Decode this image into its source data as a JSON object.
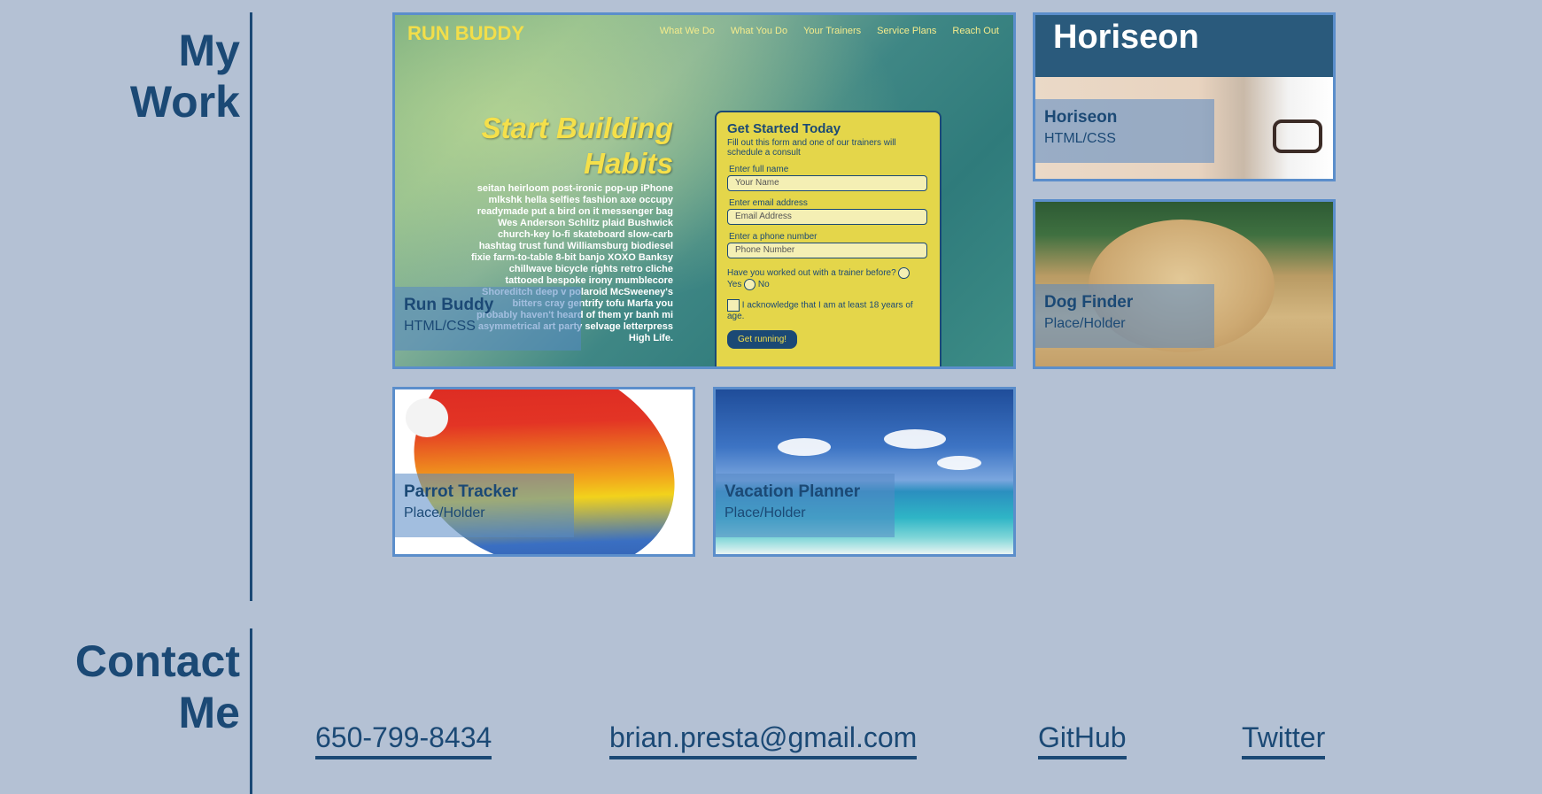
{
  "sections": {
    "work_title_line1": "My",
    "work_title_line2": "Work",
    "contact_title_line1": "Contact",
    "contact_title_line2": "Me"
  },
  "projects": [
    {
      "title": "Run Buddy",
      "subtitle": "HTML/CSS"
    },
    {
      "title": "Horiseon",
      "subtitle": "HTML/CSS"
    },
    {
      "title": "Dog Finder",
      "subtitle": "Place/Holder"
    },
    {
      "title": "Parrot Tracker",
      "subtitle": "Place/Holder"
    },
    {
      "title": "Vacation Planner",
      "subtitle": "Place/Holder"
    }
  ],
  "runbuddy_preview": {
    "logo": "RUN BUDDY",
    "nav": [
      "What We Do",
      "What You Do",
      "Your Trainers",
      "Service Plans",
      "Reach Out"
    ],
    "hero_title_line1": "Start Building",
    "hero_title_line2": "Habits",
    "hero_text": "seitan heirloom post-ironic pop-up iPhone mlkshk hella selfies fashion axe occupy readymade put a bird on it messenger bag Wes Anderson Schlitz plaid Bushwick church-key lo-fi skateboard slow-carb hashtag trust fund Williamsburg biodiesel fixie farm-to-table 8-bit banjo XOXO Banksy chillwave bicycle rights retro cliche tattooed bespoke irony mumblecore Shoreditch deep v polaroid McSweeney's bitters cray gentrify tofu Marfa you probably haven't heard of them yr banh mi asymmetrical art party selvage letterpress High Life.",
    "form": {
      "title": "Get Started Today",
      "description": "Fill out this form and one of our trainers will schedule a consult",
      "name_label": "Enter full name",
      "name_placeholder": "Your Name",
      "email_label": "Enter email address",
      "email_placeholder": "Email Address",
      "phone_label": "Enter a phone number",
      "phone_placeholder": "Phone Number",
      "question": "Have you worked out with a trainer before?",
      "yes": "Yes",
      "no": "No",
      "acknowledge": "I acknowledge that I am at least 18 years of age.",
      "button": "Get running!"
    }
  },
  "horiseon_preview": {
    "logo": "Horiseon"
  },
  "contact": {
    "phone": "650-799-8434",
    "email": "brian.presta@gmail.com",
    "github": "GitHub",
    "twitter": "Twitter"
  },
  "colors": {
    "background": "#b4c1d4",
    "accent": "#1b4975",
    "card_border": "#5b8ecb"
  }
}
